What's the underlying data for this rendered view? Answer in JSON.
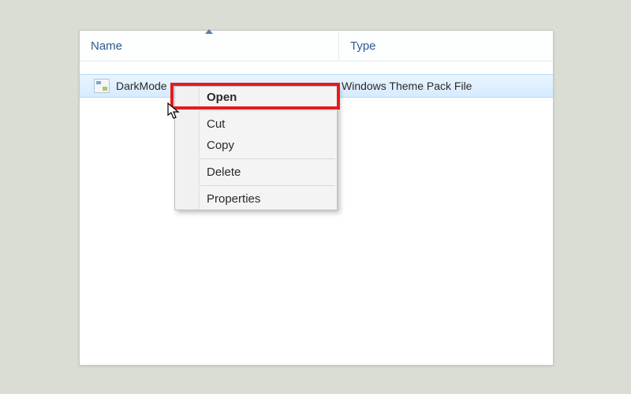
{
  "columns": {
    "name": "Name",
    "type": "Type"
  },
  "file": {
    "name": "DarkMode",
    "type": "Windows Theme Pack File"
  },
  "context_menu": {
    "open": "Open",
    "cut": "Cut",
    "copy": "Copy",
    "delete": "Delete",
    "properties": "Properties"
  }
}
